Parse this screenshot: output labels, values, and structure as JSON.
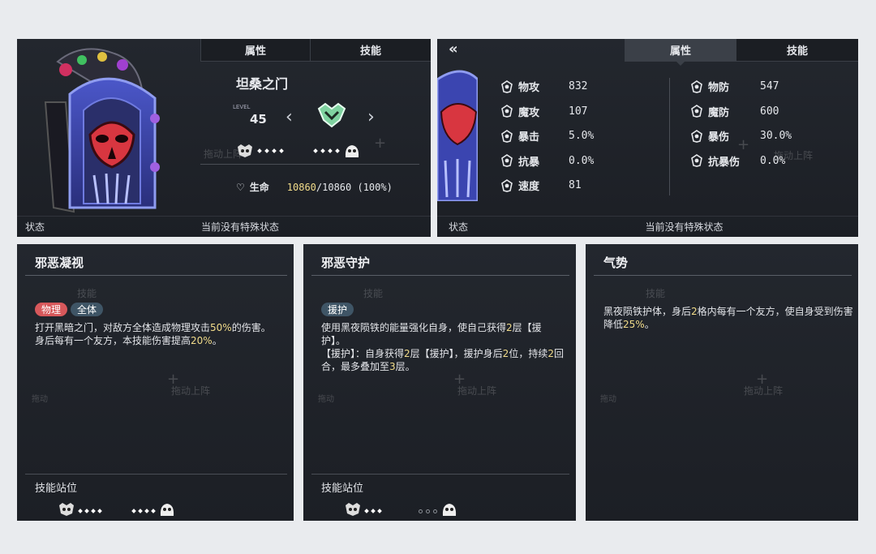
{
  "left_panel": {
    "tabs": [
      "属性",
      "技能"
    ],
    "name": "坦桑之门",
    "level_label": "LEVEL",
    "level": "45",
    "hp_label": "生命",
    "hp_current": "10860",
    "hp_rest": "/10860 (100%)",
    "status_label": "状态",
    "status_text": "当前没有特殊状态",
    "ghost_plus": "+",
    "ghost_deploy": "拖动上阵"
  },
  "right_panel": {
    "tabs": [
      "属性",
      "技能"
    ],
    "stats_left": [
      {
        "icon": "sword-icon",
        "label": "物攻",
        "value": "832"
      },
      {
        "icon": "magic-icon",
        "label": "魔攻",
        "value": "107"
      },
      {
        "icon": "crit-icon",
        "label": "暴击",
        "value": "5.0%"
      },
      {
        "icon": "crit-resist-icon",
        "label": "抗暴",
        "value": "0.0%"
      },
      {
        "icon": "speed-icon",
        "label": "速度",
        "value": "81"
      }
    ],
    "stats_right": [
      {
        "icon": "phys-def-icon",
        "label": "物防",
        "value": "547"
      },
      {
        "icon": "magic-def-icon",
        "label": "魔防",
        "value": "600"
      },
      {
        "icon": "crit-dmg-icon",
        "label": "暴伤",
        "value": "30.0%"
      },
      {
        "icon": "crit-dmg-resist-icon",
        "label": "抗暴伤",
        "value": "0.0%"
      }
    ],
    "status_label": "状态",
    "status_text": "当前没有特殊状态",
    "ghost_plus": "+",
    "ghost_deploy": "拖动上阵"
  },
  "skills": [
    {
      "title": "邪恶凝视",
      "tags": [
        "物理",
        "全体"
      ],
      "desc1_pre": "打开黑暗之门，对敌方全体造成物理攻击",
      "desc1_hl": "50%",
      "desc1_post": "的伤害。",
      "desc2_pre": "身后每有一个友方，本技能伤害提高",
      "desc2_hl": "20%",
      "desc2_post": "。",
      "pos_label": "技能站位",
      "ghost_skill": "技能",
      "ghost_deploy": "拖动上阵",
      "ghost_move": "拖动",
      "ghost_plus": "+"
    },
    {
      "title": "邪恶守护",
      "tags": [
        "援护"
      ],
      "desc1_pre": "使用黑夜陨铁的能量强化自身，使自己获得",
      "desc1_hl": "2",
      "desc1_post": "层【援护】。",
      "desc2_pre": "【援护】：自身获得",
      "desc2_hl": "2",
      "desc2_mid": "层【援护】，援护身后",
      "desc2_hl2": "2",
      "desc2_mid2": "位，持续",
      "desc2_hl3": "2",
      "desc2_mid3": "回合，最多叠加至",
      "desc2_hl4": "3",
      "desc2_post": "层。",
      "pos_label": "技能站位",
      "ghost_skill": "技能",
      "ghost_deploy": "拖动上阵",
      "ghost_move": "拖动",
      "ghost_plus": "+"
    },
    {
      "title": "气势",
      "desc1_pre": "黑夜陨铁护体，身后",
      "desc1_hl": "2",
      "desc1_mid": "格内每有一个友方，使自身受到伤害降低",
      "desc1_hl2": "25%",
      "desc1_post": "。",
      "ghost_skill": "技能",
      "ghost_deploy": "拖动上阵",
      "ghost_move": "拖动",
      "ghost_plus": "+"
    }
  ],
  "colors": {
    "panel_bg": "#1f2228",
    "highlight": "#f2dc8a",
    "tag_physical": "#d7585b",
    "tag_neutral": "#3f5566",
    "hp_value": "#f2dc8a"
  }
}
